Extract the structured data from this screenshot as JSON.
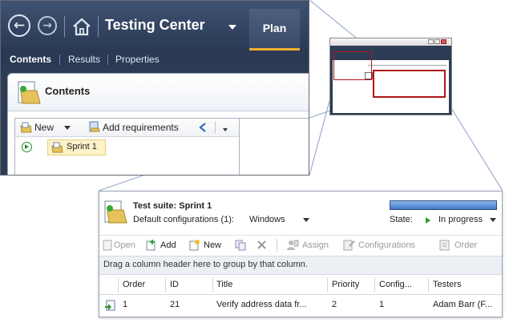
{
  "top_window": {
    "app_title": "Testing Center",
    "main_tab": "Plan",
    "subtabs": [
      "Contents",
      "Results",
      "Properties"
    ],
    "panel_title": "Contents",
    "toolbar": {
      "new_label": "New",
      "add_requirements_label": "Add requirements"
    },
    "tree_items": [
      "Sprint 1"
    ]
  },
  "bottom_window": {
    "suite_label": "Test suite:  Sprint 1",
    "config_label": "Default configurations (1):",
    "config_value": "Windows",
    "state_label": "State:",
    "state_value": "In progress",
    "progress_fraction": 1.0,
    "toolbar": [
      "Open",
      "Add",
      "New",
      "Assign",
      "Configurations",
      "Order"
    ],
    "group_hint": "Drag a column header here to group by that column.",
    "columns": [
      "Order",
      "ID",
      "Title",
      "Priority",
      "Config...",
      "Testers"
    ],
    "rows": [
      {
        "order": "1",
        "id": "21",
        "title": "Verify address data fr...",
        "priority": "2",
        "config": "1",
        "testers": "Adam Barr (F..."
      }
    ]
  },
  "colors": {
    "titlebar": "#2c3c55",
    "accent": "#f0b030",
    "highlight_box": "#b01818",
    "progress": "#3f78c8"
  }
}
